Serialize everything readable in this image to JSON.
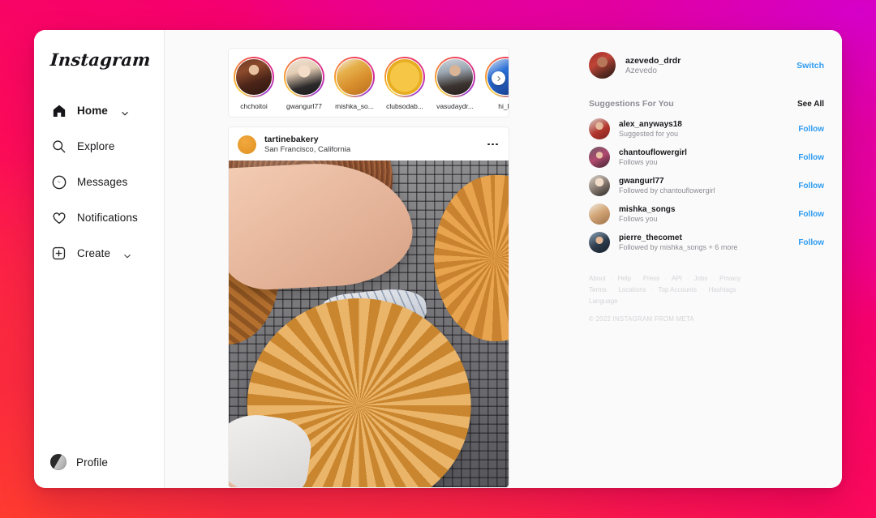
{
  "brand": {
    "name": "Instagram"
  },
  "sidebar": {
    "items": [
      {
        "label": "Home",
        "icon": "home-icon",
        "active": true,
        "chevron": true
      },
      {
        "label": "Explore",
        "icon": "search-icon",
        "active": false,
        "chevron": false
      },
      {
        "label": "Messages",
        "icon": "messenger-icon",
        "active": false,
        "chevron": false
      },
      {
        "label": "Notifications",
        "icon": "heart-icon",
        "active": false,
        "chevron": false
      },
      {
        "label": "Create",
        "icon": "plus-square-icon",
        "active": false,
        "chevron": true
      }
    ],
    "profile": {
      "label": "Profile",
      "icon": "profile-avatar"
    }
  },
  "stories": [
    {
      "name": "chchoitoi"
    },
    {
      "name": "gwangurl77"
    },
    {
      "name": "mishka_so..."
    },
    {
      "name": "clubsodab..."
    },
    {
      "name": "vasudaydr..."
    },
    {
      "name": "hi_ki"
    }
  ],
  "post": {
    "username": "tartinebakery",
    "location": "San Francisco, California",
    "more_icon": "ellipsis-icon",
    "image_alt": "Freshly baked pies cooling on a wire rack"
  },
  "account": {
    "username": "azevedo_drdr",
    "fullname": "Azevedo",
    "switch_label": "Switch"
  },
  "suggestions": {
    "title": "Suggestions For You",
    "see_all_label": "See All",
    "follow_label": "Follow",
    "items": [
      {
        "username": "alex_anyways18",
        "subtitle": "Suggested for you",
        "action": "Follow"
      },
      {
        "username": "chantouflowergirl",
        "subtitle": "Follows you",
        "action": "Follow"
      },
      {
        "username": "gwangurl77",
        "subtitle": "Followed by chantouflowergirl",
        "action": "Follow"
      },
      {
        "username": "mishka_songs",
        "subtitle": "Follows you",
        "action": "Follow"
      },
      {
        "username": "pierre_thecomet",
        "subtitle": "Followed by mishka_songs + 6 more",
        "action": "Follow"
      }
    ]
  },
  "footer": {
    "links_row1": [
      "About",
      "Help",
      "Press",
      "API",
      "Jobs",
      "Privacy",
      "Terms"
    ],
    "links_row2": [
      "Locations",
      "Top Accounts",
      "Hashtags",
      "Language"
    ],
    "copyright": "© 2022 INSTAGRAM FROM META"
  },
  "colors": {
    "accent_blue": "#2c9bf0",
    "text_primary": "#17171a",
    "text_muted": "#8d8d93",
    "bg_gradient_start": "#ff3b30",
    "bg_gradient_mid": "#f5006e",
    "bg_gradient_end": "#d500c8"
  }
}
